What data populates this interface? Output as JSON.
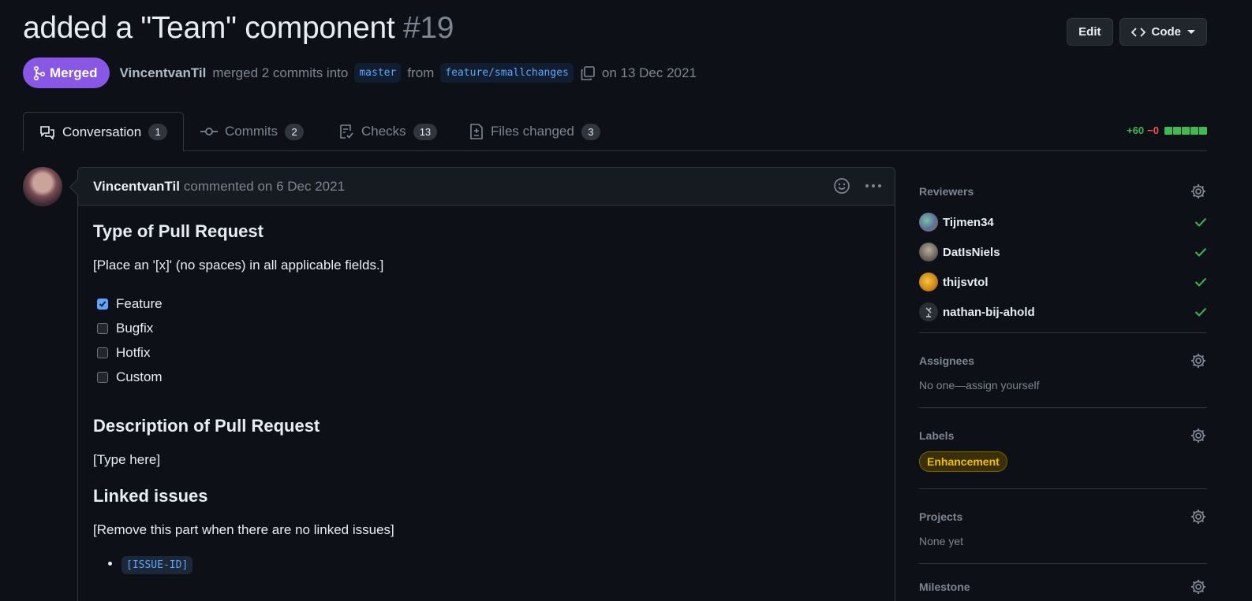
{
  "pr": {
    "title": "added a \"Team\" component",
    "number": "#19",
    "status_label": "Merged",
    "merger": "VincentvanTil",
    "merge_text": "merged 2 commits into",
    "base_branch": "master",
    "from_text": "from",
    "head_branch": "feature/smallchanges",
    "merge_date": "on 13 Dec 2021"
  },
  "header_actions": {
    "edit_label": "Edit",
    "code_label": "Code"
  },
  "tabs": [
    {
      "label": "Conversation",
      "count": "1",
      "icon": "comment-discussion-icon"
    },
    {
      "label": "Commits",
      "count": "2",
      "icon": "git-commit-icon"
    },
    {
      "label": "Checks",
      "count": "13",
      "icon": "checklist-icon"
    },
    {
      "label": "Files changed",
      "count": "3",
      "icon": "file-diff-icon"
    }
  ],
  "diffstat": {
    "additions": "+60",
    "deletions": "−0",
    "blocks": 5
  },
  "comment": {
    "author": "VincentvanTil",
    "meta": "commented on 6 Dec 2021",
    "heading_type": "Type of Pull Request",
    "instruction": "[Place an '[x]' (no spaces) in all applicable fields.]",
    "tasks": [
      {
        "label": "Feature",
        "checked": true
      },
      {
        "label": "Bugfix",
        "checked": false
      },
      {
        "label": "Hotfix",
        "checked": false
      },
      {
        "label": "Custom",
        "checked": false
      }
    ],
    "heading_description": "Description of Pull Request",
    "description": "[Type here]",
    "heading_linked": "Linked issues",
    "linked_instruction": "[Remove this part when there are no linked issues]",
    "issue_placeholder": "[ISSUE-ID]"
  },
  "sidebar": {
    "reviewers_title": "Reviewers",
    "reviewers": [
      {
        "name": "Tijmen34",
        "status": "approved"
      },
      {
        "name": "DatIsNiels",
        "status": "approved"
      },
      {
        "name": "thijsvtol",
        "status": "approved"
      },
      {
        "name": "nathan-bij-ahold",
        "status": "approved"
      }
    ],
    "assignees_title": "Assignees",
    "assignees_empty": "No one—assign yourself",
    "labels_title": "Labels",
    "label": "Enhancement",
    "projects_title": "Projects",
    "projects_empty": "None yet",
    "milestone_title": "Milestone"
  },
  "colors": {
    "background": "#0d1117",
    "merged": "#8957e5",
    "link": "#58a6ff",
    "success": "#3fb950",
    "danger": "#f85149",
    "label_text": "#f0c000"
  }
}
